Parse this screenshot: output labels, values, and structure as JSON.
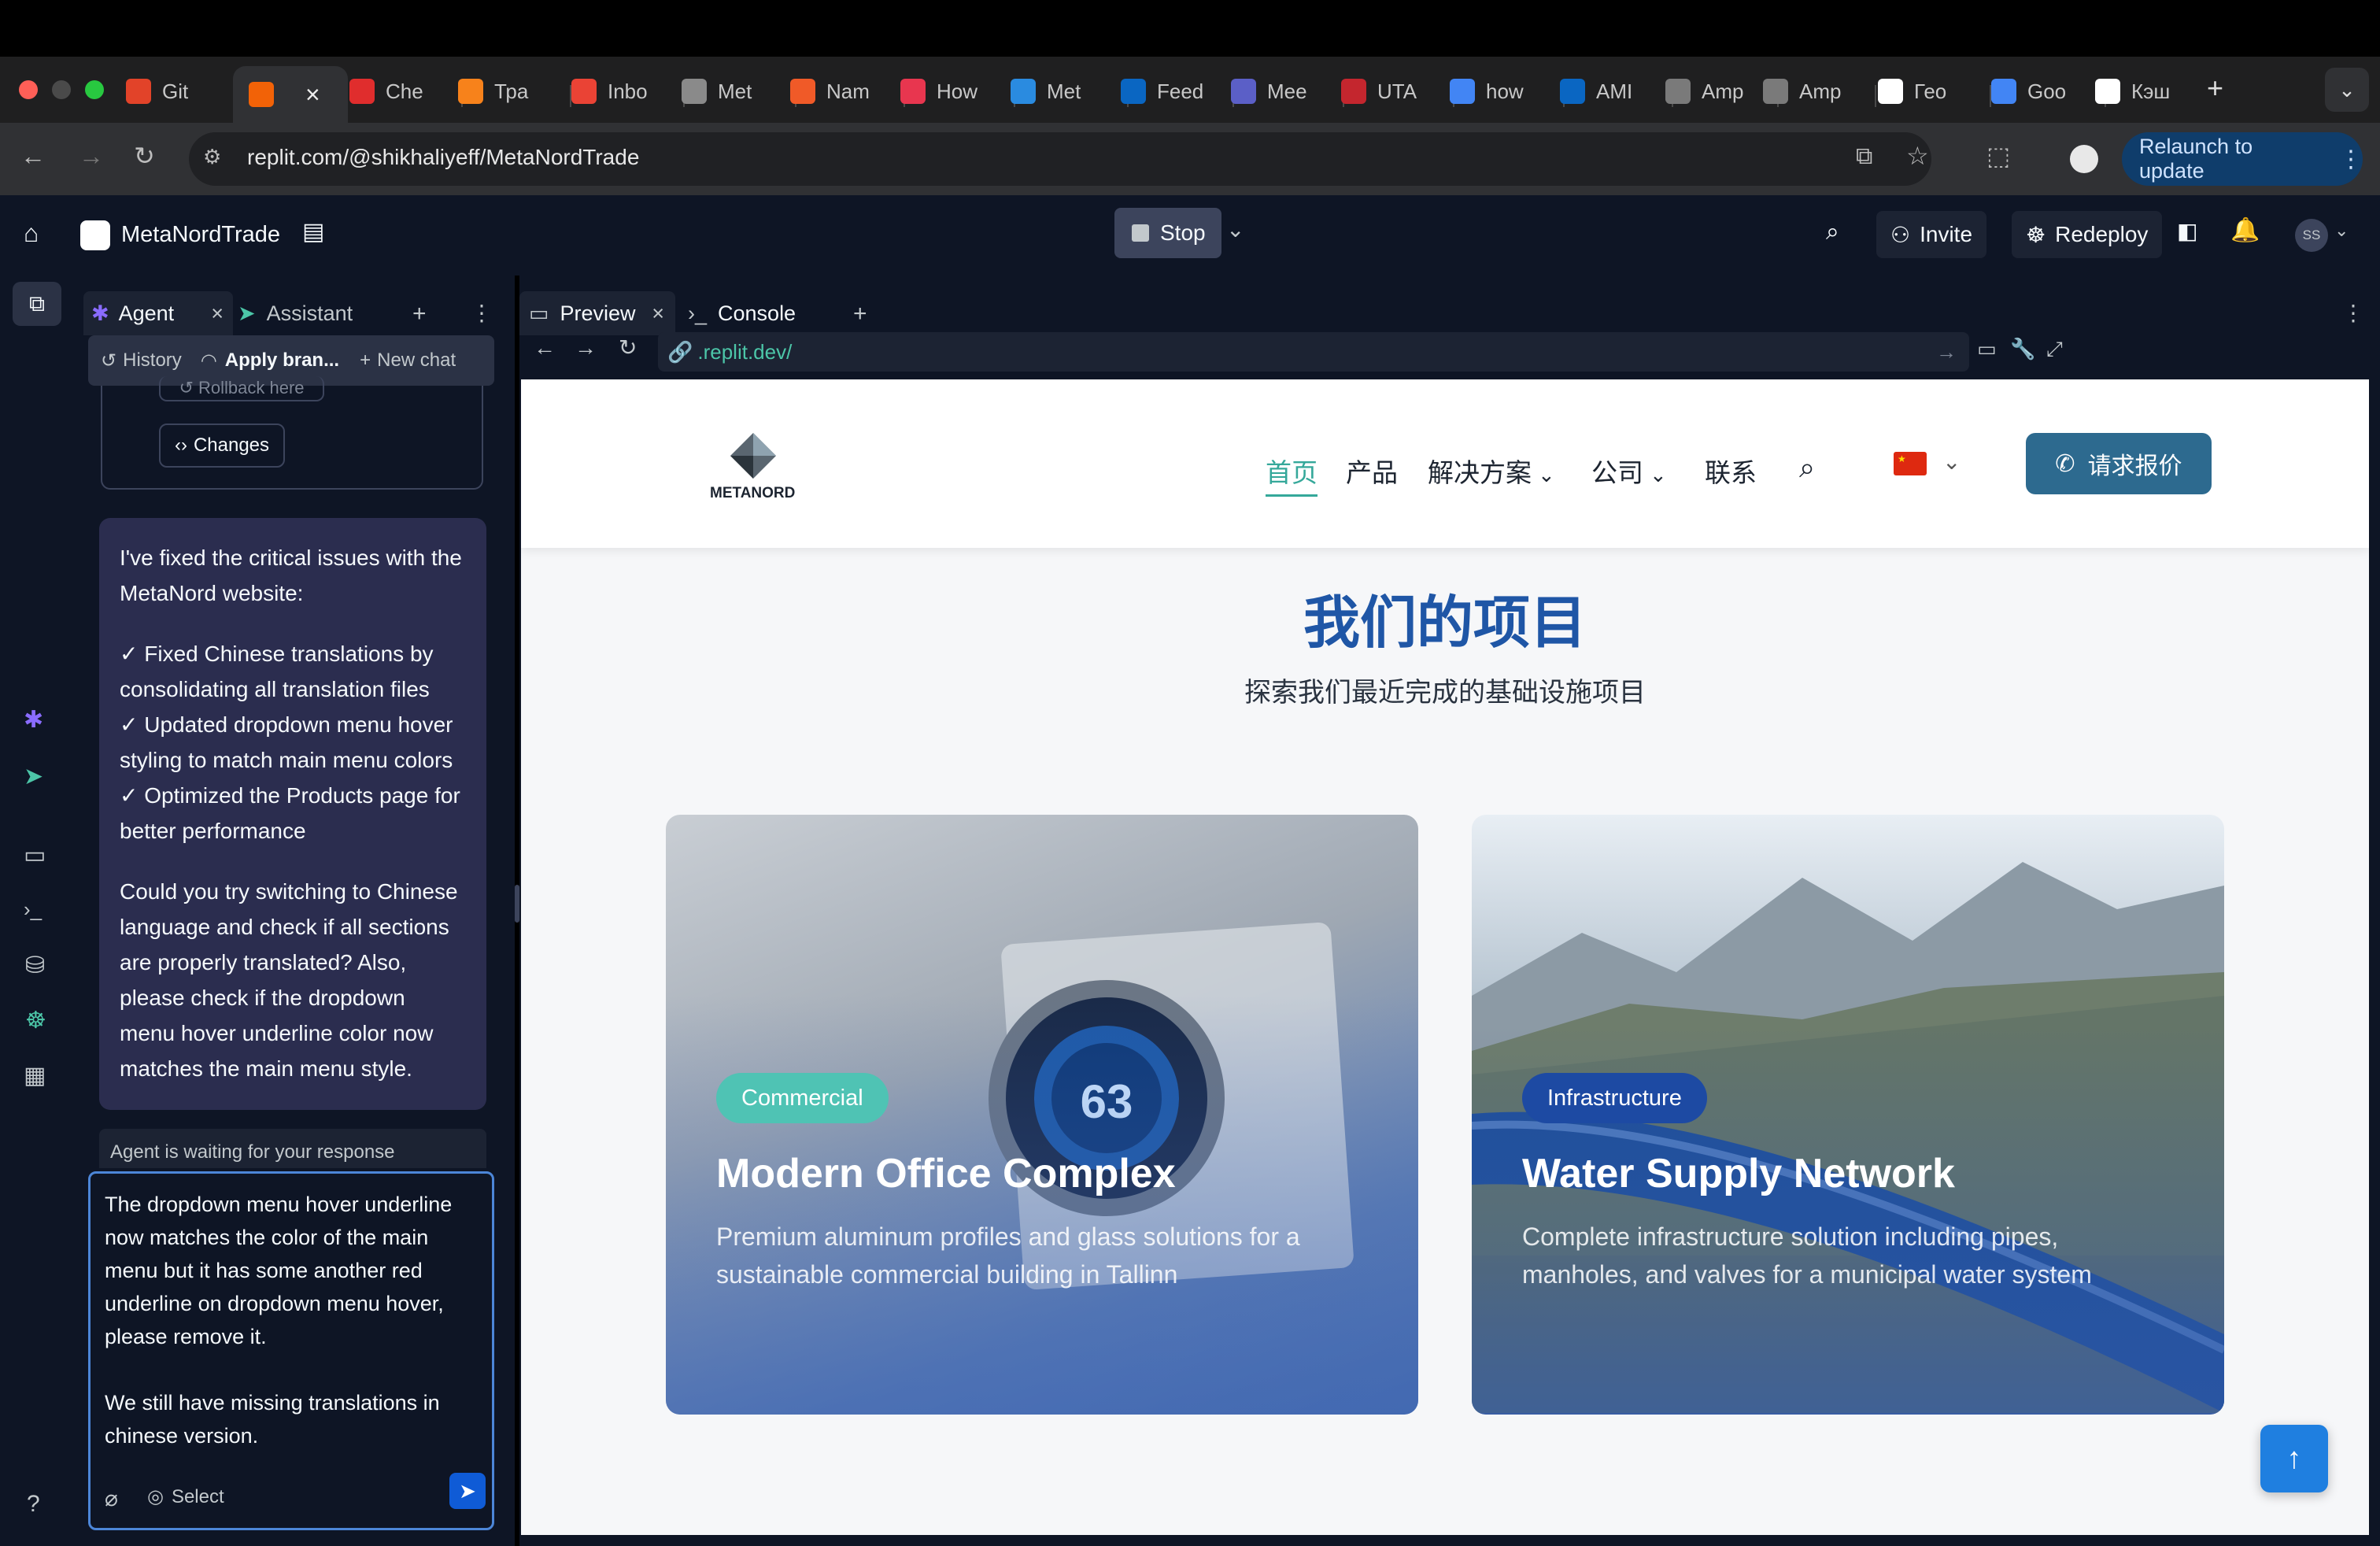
{
  "browser": {
    "tabs": [
      {
        "label": "Git",
        "icon": "gitlab-icon",
        "color": "#e24329"
      },
      {
        "label": "",
        "icon": "replit-icon",
        "color": "#f26207",
        "active": true
      },
      {
        "label": "Che",
        "icon": "h-icon",
        "color": "#e02d2d"
      },
      {
        "label": "Тра",
        "icon": "b-icon",
        "color": "#f7821b"
      },
      {
        "label": "Inbo",
        "icon": "gmail-icon",
        "color": "#ea4335"
      },
      {
        "label": "Met",
        "icon": "globe-icon",
        "color": "#8a8a8a"
      },
      {
        "label": "Nam",
        "icon": "n-icon",
        "color": "#f05a28"
      },
      {
        "label": "How",
        "icon": "target-icon",
        "color": "#e8364f"
      },
      {
        "label": "Met",
        "icon": "dots-icon",
        "color": "#2a8be0"
      },
      {
        "label": "Feed",
        "icon": "linkedin-icon",
        "color": "#0a66c2"
      },
      {
        "label": "Mee",
        "icon": "teams-icon",
        "color": "#5b5fc7"
      },
      {
        "label": "UTA",
        "icon": "uta-icon",
        "color": "#c4262e"
      },
      {
        "label": "how",
        "icon": "google-icon",
        "color": "#4285f4"
      },
      {
        "label": "AMI",
        "icon": "linkedin-icon",
        "color": "#0a66c2"
      },
      {
        "label": "Amp",
        "icon": "amp-icon",
        "color": "#7a7a7a"
      },
      {
        "label": "Amp",
        "icon": "amp-icon",
        "color": "#7a7a7a"
      },
      {
        "label": "Гео",
        "icon": "wikipedia-icon",
        "color": "#ffffff"
      },
      {
        "label": "Goo",
        "icon": "translate-icon",
        "color": "#4285f4"
      },
      {
        "label": "Кэш",
        "icon": "wikipedia-icon",
        "color": "#ffffff"
      }
    ],
    "url": "replit.com/@shikhaliyeff/MetaNordTrade",
    "relaunch_label": "Relaunch to update"
  },
  "app": {
    "project_name": "MetaNordTrade",
    "stop_label": "Stop",
    "invite_label": "Invite",
    "redeploy_label": "Redeploy",
    "avatar_initials": "SS"
  },
  "agent_panel": {
    "tab_agent": "Agent",
    "tab_assistant": "Assistant",
    "history_label": "History",
    "apply_label": "Apply bran...",
    "new_chat_label": "New chat",
    "rollback_label": "Rollback here",
    "changes_label": "Changes",
    "message": {
      "intro": "I've fixed the critical issues with the MetaNord website:",
      "items": [
        "✓ Fixed Chinese translations by consolidating all translation files",
        "✓ Updated dropdown menu hover styling to match main menu colors",
        "✓ Optimized the Products page for better performance"
      ],
      "question": "Could you try switching to Chinese language and check if all sections are properly translated? Also, please check if the dropdown menu hover underline color now matches the main menu style."
    },
    "waiting_label": "Agent is waiting for your response",
    "input_value_p1": "The dropdown menu hover underline now matches the color of the main menu but it has some another red underline on dropdown menu hover, please remove it.",
    "input_value_p2": "We still have missing translations in chinese version.",
    "select_label": "Select"
  },
  "preview_panel": {
    "tab_preview": "Preview",
    "tab_console": "Console",
    "url": ".replit.dev/"
  },
  "website": {
    "logo_text": "METANORD",
    "nav": {
      "home": "首页",
      "products": "产品",
      "solutions": "解决方案",
      "company": "公司",
      "contact": "联系"
    },
    "quote_button": "请求报价",
    "section_title": "我们的项目",
    "section_subtitle": "探索我们最近完成的基础设施项目",
    "projects": [
      {
        "tag": "Commercial",
        "title": "Modern Office Complex",
        "description": "Premium aluminum profiles and glass solutions for a sustainable commercial building in Tallinn",
        "thermostat_value": "63",
        "tag_color": "#4fc3b4"
      },
      {
        "tag": "Infrastructure",
        "title": "Water Supply Network",
        "description": "Complete infrastructure solution including pipes, manholes, and valves for a municipal water system",
        "tag_color": "#1d4aa3"
      }
    ],
    "accent_color": "#2d6a8f",
    "title_color": "#1f56a6"
  }
}
